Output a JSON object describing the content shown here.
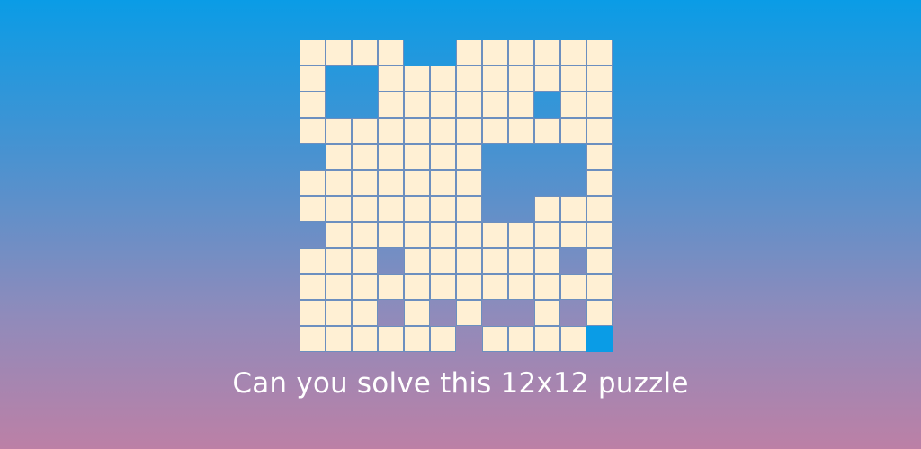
{
  "caption": "Can you solve this 12x12 puzzle",
  "colors": {
    "cell_fill": "#fff0d4",
    "cell_border": "#6c8fbf",
    "marker": "#0a9ce6",
    "text": "#ffffff"
  },
  "puzzle": {
    "rows": 12,
    "cols": 12,
    "grid": [
      "####..######",
      "#..#########",
      "#..######.##",
      "############",
      ".######....#",
      "#######....#",
      "#######..###",
      ".###########",
      "###.######.#",
      "############",
      "###.#.#..#.#",
      "######.####B"
    ]
  }
}
